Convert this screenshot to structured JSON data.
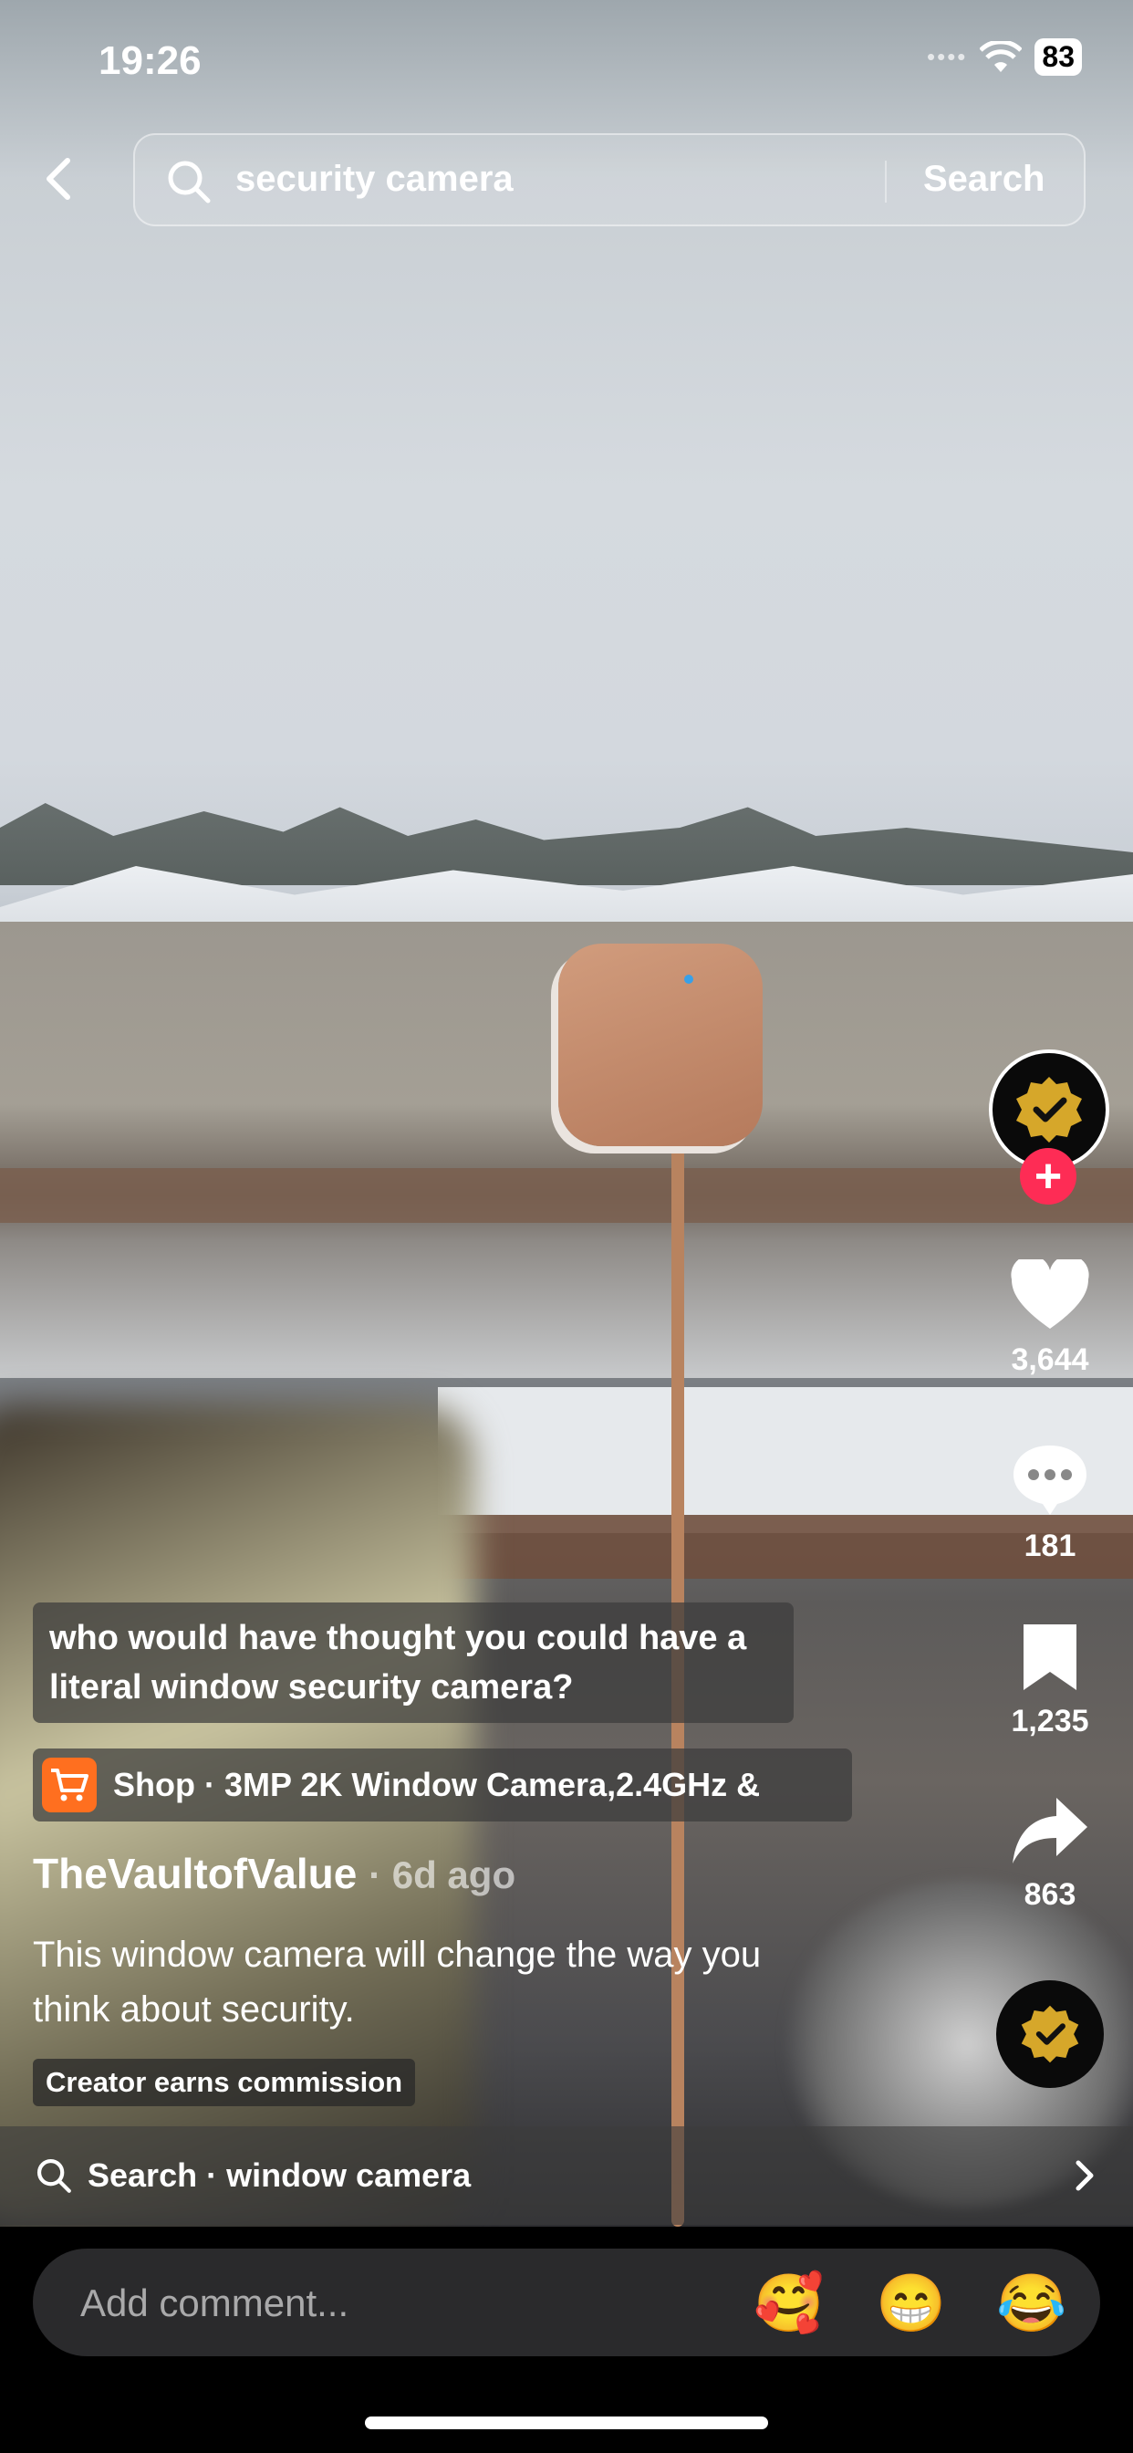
{
  "status_bar": {
    "time": "19:26",
    "battery": "83"
  },
  "search": {
    "query": "security camera",
    "button": "Search"
  },
  "actions": {
    "likes": "3,644",
    "comments": "181",
    "saves": "1,235",
    "shares": "863"
  },
  "caption_overlay": "who would have thought you could have a literal window security camera?",
  "shop": {
    "label": "Shop · 3MP 2K Window Camera,2.4GHz &"
  },
  "author": {
    "username": "TheVaultofValue",
    "posted": "· 6d ago"
  },
  "description": "This window camera will change the way you think about security.",
  "commission_badge": "Creator earns commission",
  "search_suggestion": "Search · window camera",
  "comment": {
    "placeholder": "Add comment...",
    "emojis": [
      "🥰",
      "😁",
      "😂"
    ]
  },
  "colors": {
    "follow": "#fe2c55",
    "shop": "#ff6f1f",
    "badge_gold": "#d6a72a"
  }
}
